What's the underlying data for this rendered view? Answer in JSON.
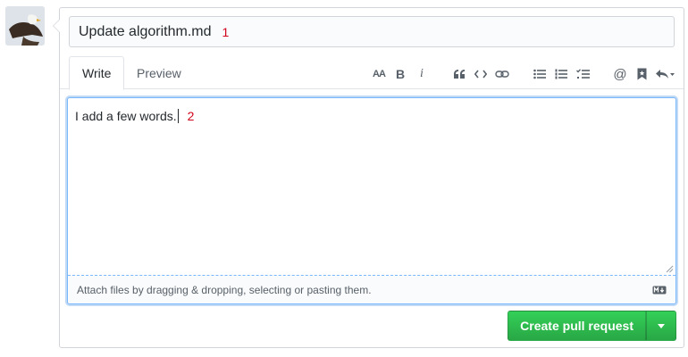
{
  "title_field": {
    "value": "Update algorithm.md",
    "marker": "1"
  },
  "tabs": [
    {
      "label": "Write",
      "active": true
    },
    {
      "label": "Preview",
      "active": false
    }
  ],
  "toolbar": {
    "heading": "AA",
    "bold": "B",
    "italic": "i",
    "mention": "@"
  },
  "editor": {
    "value": "I add a few words.",
    "marker": "2"
  },
  "attach": {
    "text": "Attach files by dragging & dropping, selecting or pasting them."
  },
  "submit": {
    "label": "Create pull request"
  },
  "colors": {
    "primary_button": "#2ea44f",
    "focus_border": "#79b8ff",
    "marker": "#d0021b"
  }
}
